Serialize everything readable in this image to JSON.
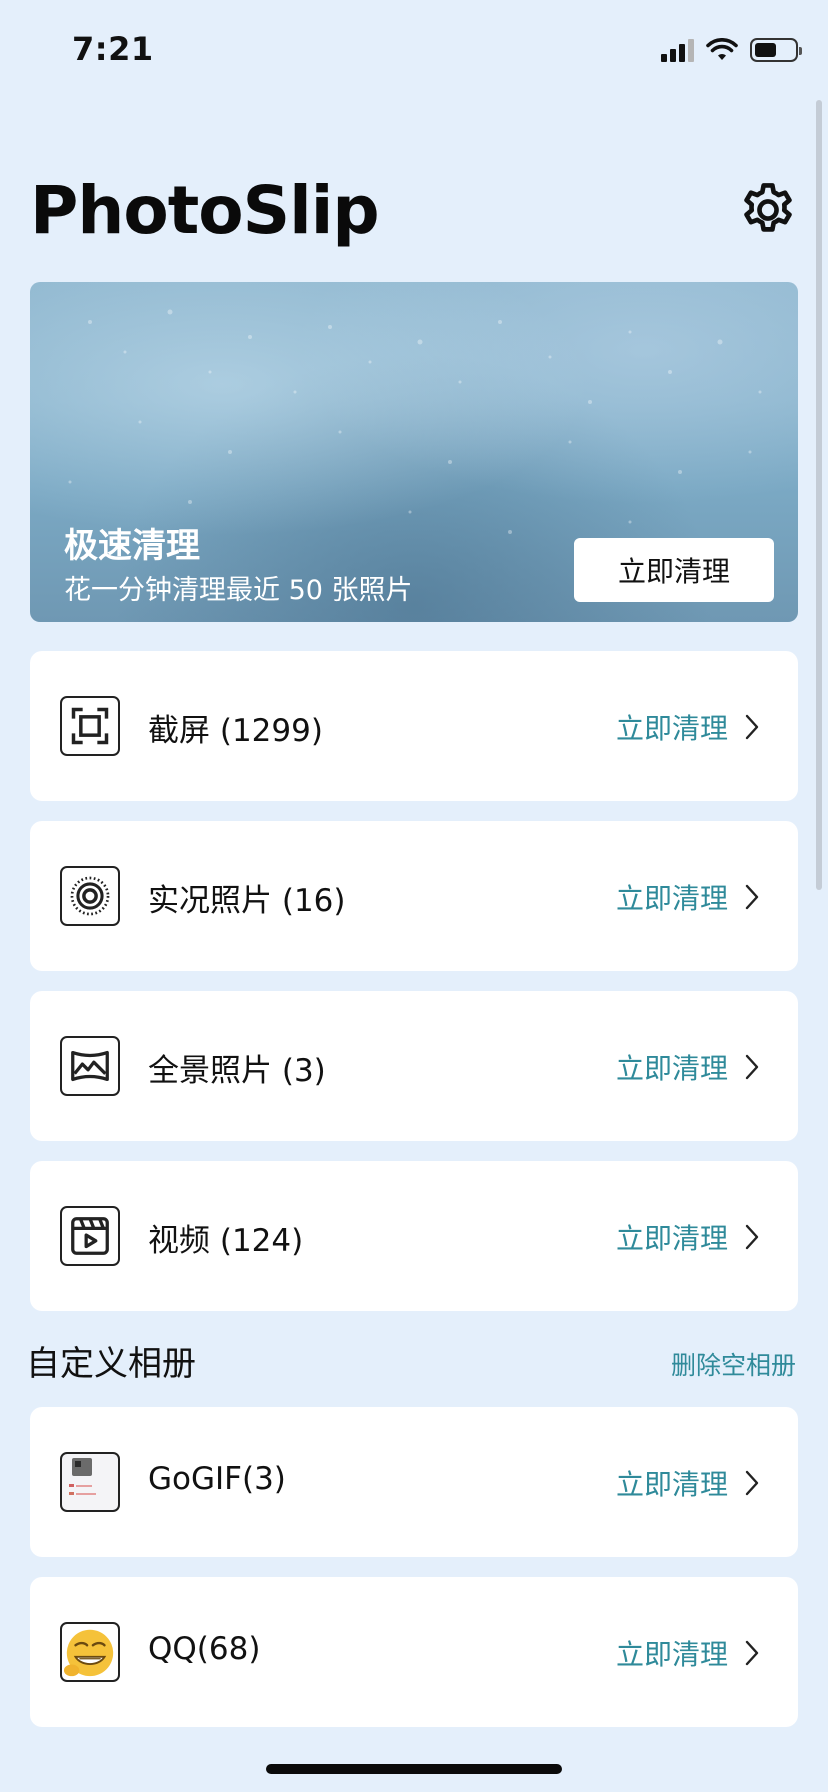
{
  "status_bar": {
    "time": "7:21",
    "battery_percent": 55
  },
  "header": {
    "title": "PhotoSlip",
    "settings_icon": "gear-icon"
  },
  "hero": {
    "title": "极速清理",
    "subtitle": "花一分钟清理最近 50 张照片",
    "button_label": "立即清理"
  },
  "categories": [
    {
      "label": "截屏 (1299)",
      "action": "立即清理",
      "icon": "screenshot-icon"
    },
    {
      "label": "实况照片 (16)",
      "action": "立即清理",
      "icon": "live-photo-icon"
    },
    {
      "label": "全景照片 (3)",
      "action": "立即清理",
      "icon": "panorama-icon"
    },
    {
      "label": "视频 (124)",
      "action": "立即清理",
      "icon": "video-icon"
    }
  ],
  "custom_albums": {
    "title": "自定义相册",
    "action": "删除空相册",
    "items": [
      {
        "label": "GoGIF(3)",
        "action": "立即清理",
        "icon": "gogif-album-thumbnail"
      },
      {
        "label": "QQ(68)",
        "action": "立即清理",
        "icon": "qq-album-thumbnail"
      }
    ]
  }
}
